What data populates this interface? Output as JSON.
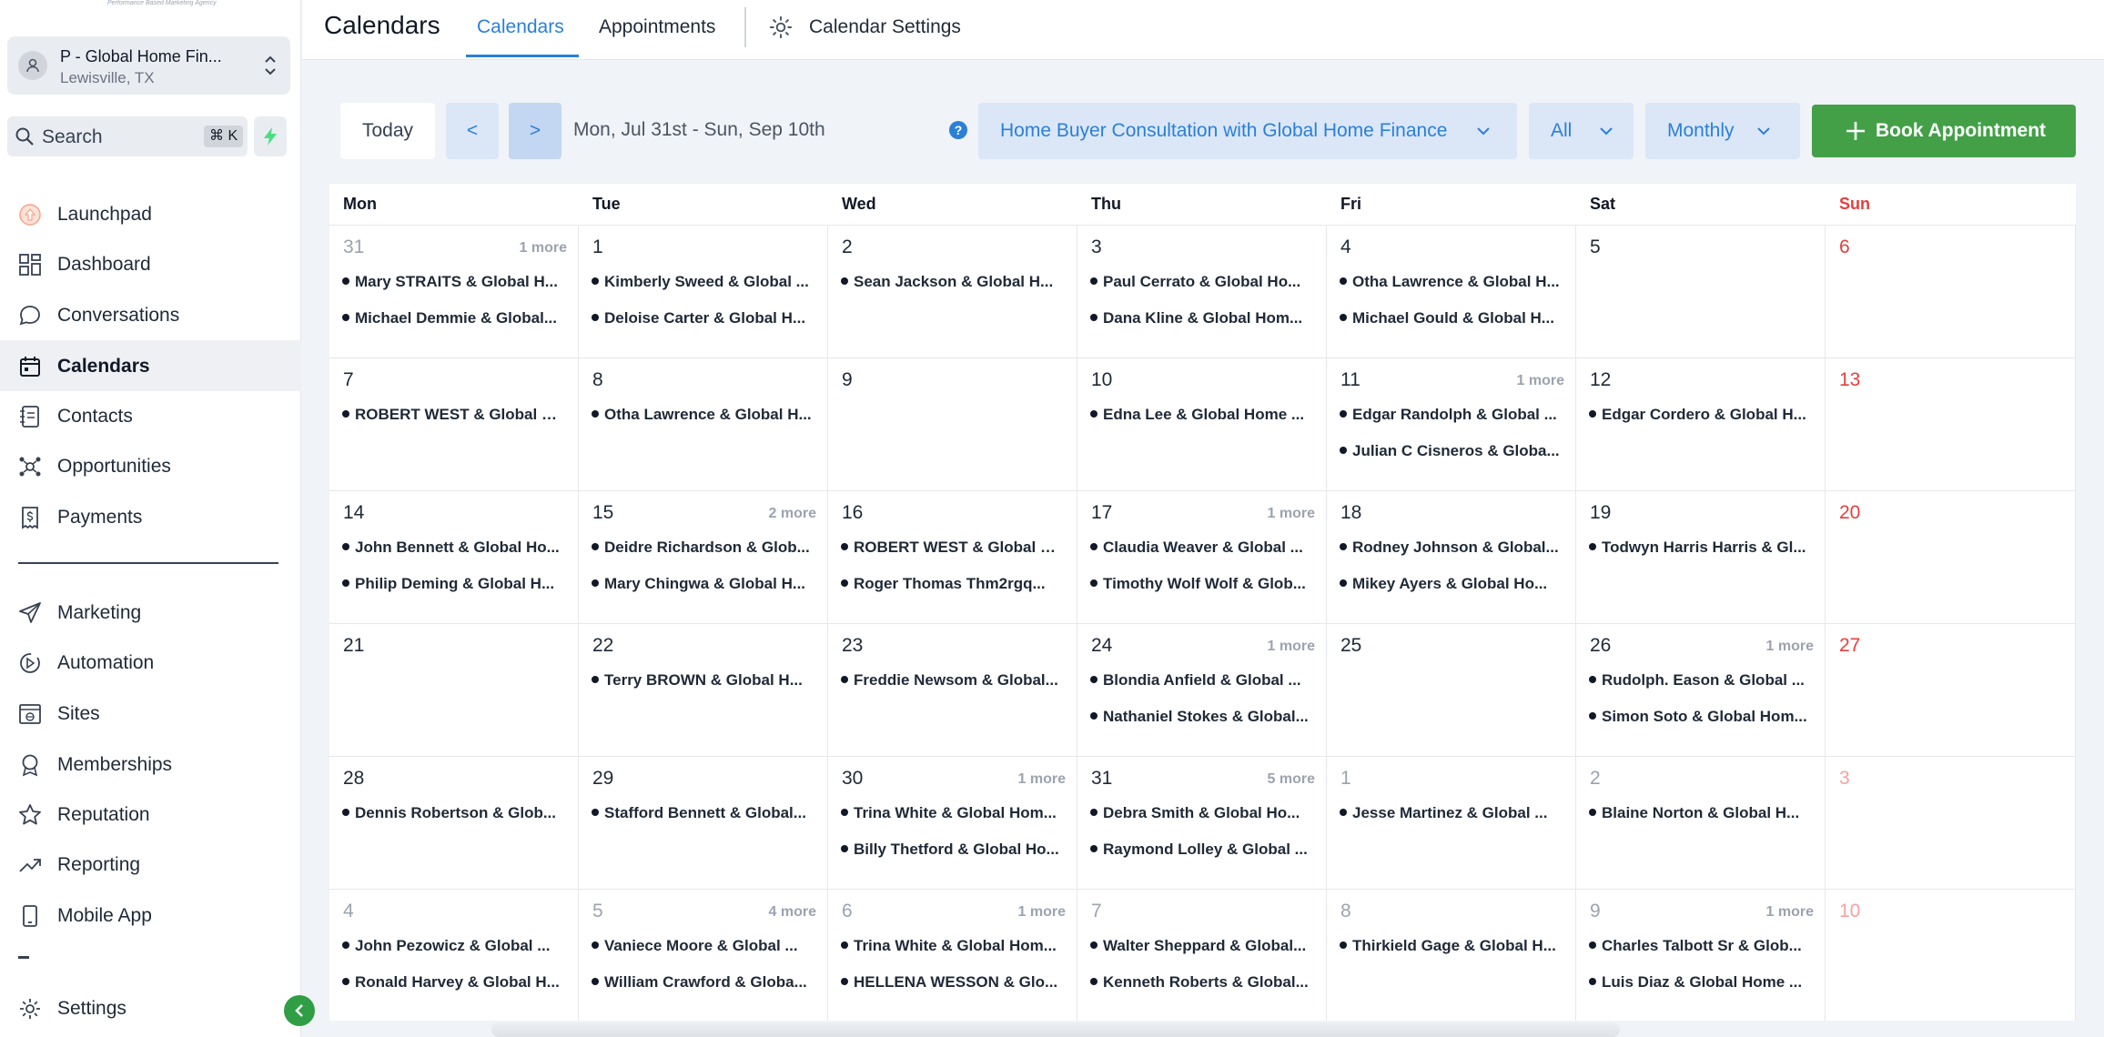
{
  "sidebar": {
    "agency_tagline": "Performance Based Marketing Agency",
    "location": {
      "name": "P - Global Home Fin...",
      "city": "Lewisville, TX"
    },
    "search": {
      "label": "Search",
      "shortcut": "⌘ K"
    },
    "items": [
      {
        "label": "Launchpad",
        "icon": "launchpad-icon"
      },
      {
        "label": "Dashboard",
        "icon": "dashboard-icon"
      },
      {
        "label": "Conversations",
        "icon": "chat-bubble-icon"
      },
      {
        "label": "Calendars",
        "icon": "calendar-icon",
        "active": true
      },
      {
        "label": "Contacts",
        "icon": "contacts-icon"
      },
      {
        "label": "Opportunities",
        "icon": "opportunities-icon"
      },
      {
        "label": "Payments",
        "icon": "payments-icon"
      }
    ],
    "items2": [
      {
        "label": "Marketing",
        "icon": "send-icon"
      },
      {
        "label": "Automation",
        "icon": "automation-icon"
      },
      {
        "label": "Sites",
        "icon": "sites-icon"
      },
      {
        "label": "Memberships",
        "icon": "award-icon"
      },
      {
        "label": "Reputation",
        "icon": "star-icon"
      },
      {
        "label": "Reporting",
        "icon": "trend-icon"
      },
      {
        "label": "Mobile App",
        "icon": "mobile-icon"
      }
    ],
    "settings_label": "Settings"
  },
  "header": {
    "title": "Calendars",
    "tabs": [
      {
        "label": "Calendars",
        "active": true
      },
      {
        "label": "Appointments"
      },
      {
        "label": "Calendar Settings"
      }
    ]
  },
  "toolbar": {
    "today": "Today",
    "prev": "<",
    "next": ">",
    "date_range": "Mon, Jul 31st - Sun, Sep 10th",
    "calendar_select": "Home Buyer Consultation with Global Home Finance",
    "filter_select": "All",
    "view_select": "Monthly",
    "book_label": "Book Appointment"
  },
  "colors": {
    "accent": "#2b7fd8",
    "book_green": "#43a047",
    "sunday_red": "#e53e3e"
  },
  "weekdays": [
    "Mon",
    "Tue",
    "Wed",
    "Thu",
    "Fri",
    "Sat",
    "Sun"
  ],
  "weeks": [
    [
      {
        "day": "31",
        "other": true,
        "more": "1 more",
        "events": [
          "Mary STRAITS & Global H...",
          "Michael Demmie & Global..."
        ]
      },
      {
        "day": "1",
        "events": [
          "Kimberly Sweed & Global ...",
          "Deloise Carter & Global H..."
        ]
      },
      {
        "day": "2",
        "events": [
          "Sean Jackson & Global H..."
        ]
      },
      {
        "day": "3",
        "events": [
          "Paul Cerrato & Global Ho...",
          "Dana Kline & Global Hom..."
        ]
      },
      {
        "day": "4",
        "events": [
          "Otha Lawrence & Global H...",
          "Michael Gould & Global H..."
        ]
      },
      {
        "day": "5",
        "events": []
      },
      {
        "day": "6",
        "events": []
      }
    ],
    [
      {
        "day": "7",
        "events": [
          "ROBERT WEST & Global H..."
        ]
      },
      {
        "day": "8",
        "events": [
          "Otha Lawrence & Global H..."
        ]
      },
      {
        "day": "9",
        "events": []
      },
      {
        "day": "10",
        "events": [
          "Edna Lee & Global Home ..."
        ]
      },
      {
        "day": "11",
        "more": "1 more",
        "events": [
          "Edgar Randolph & Global ...",
          "Julian C Cisneros & Globa..."
        ]
      },
      {
        "day": "12",
        "events": [
          "Edgar Cordero & Global H..."
        ]
      },
      {
        "day": "13",
        "events": []
      }
    ],
    [
      {
        "day": "14",
        "events": [
          "John Bennett & Global Ho...",
          "Philip Deming & Global H..."
        ]
      },
      {
        "day": "15",
        "more": "2 more",
        "events": [
          "Deidre Richardson & Glob...",
          "Mary Chingwa & Global H..."
        ]
      },
      {
        "day": "16",
        "events": [
          "ROBERT WEST & Global H...",
          "Roger Thomas Thm2rgq..."
        ]
      },
      {
        "day": "17",
        "more": "1 more",
        "events": [
          "Claudia Weaver & Global ...",
          "Timothy Wolf Wolf & Glob..."
        ]
      },
      {
        "day": "18",
        "events": [
          "Rodney Johnson & Global...",
          "Mikey Ayers & Global Ho..."
        ]
      },
      {
        "day": "19",
        "events": [
          "Todwyn Harris Harris & Gl..."
        ]
      },
      {
        "day": "20",
        "events": []
      }
    ],
    [
      {
        "day": "21",
        "events": []
      },
      {
        "day": "22",
        "events": [
          "Terry BROWN & Global H..."
        ]
      },
      {
        "day": "23",
        "events": [
          "Freddie Newsom & Global..."
        ]
      },
      {
        "day": "24",
        "more": "1 more",
        "events": [
          "Blondia Anfield & Global ...",
          "Nathaniel Stokes & Global..."
        ]
      },
      {
        "day": "25",
        "events": []
      },
      {
        "day": "26",
        "more": "1 more",
        "events": [
          "Rudolph. Eason & Global ...",
          "Simon Soto & Global Hom..."
        ]
      },
      {
        "day": "27",
        "events": []
      }
    ],
    [
      {
        "day": "28",
        "events": [
          "Dennis Robertson & Glob..."
        ]
      },
      {
        "day": "29",
        "events": [
          "Stafford Bennett & Global..."
        ]
      },
      {
        "day": "30",
        "more": "1 more",
        "events": [
          "Trina White & Global Hom...",
          "Billy Thetford & Global Ho..."
        ]
      },
      {
        "day": "31",
        "more": "5 more",
        "events": [
          "Debra Smith & Global Ho...",
          "Raymond Lolley & Global ..."
        ]
      },
      {
        "day": "1",
        "other": true,
        "events": [
          "Jesse Martinez & Global ..."
        ]
      },
      {
        "day": "2",
        "other": true,
        "events": [
          "Blaine Norton & Global H..."
        ]
      },
      {
        "day": "3",
        "other": true,
        "events": []
      }
    ],
    [
      {
        "day": "4",
        "other": true,
        "events": [
          "John Pezowicz & Global ...",
          "Ronald Harvey & Global H..."
        ]
      },
      {
        "day": "5",
        "other": true,
        "more": "4 more",
        "events": [
          "Vaniece Moore & Global ...",
          "William Crawford & Globa..."
        ]
      },
      {
        "day": "6",
        "other": true,
        "more": "1 more",
        "events": [
          "Trina White & Global Hom...",
          "HELLENA WESSON & Glo..."
        ]
      },
      {
        "day": "7",
        "other": true,
        "events": [
          "Walter Sheppard & Global...",
          "Kenneth Roberts & Global..."
        ]
      },
      {
        "day": "8",
        "other": true,
        "events": [
          "Thirkield Gage & Global H..."
        ]
      },
      {
        "day": "9",
        "other": true,
        "more": "1 more",
        "events": [
          "Charles Talbott Sr & Glob...",
          "Luis Diaz & Global Home ..."
        ]
      },
      {
        "day": "10",
        "other": true,
        "events": []
      }
    ]
  ]
}
